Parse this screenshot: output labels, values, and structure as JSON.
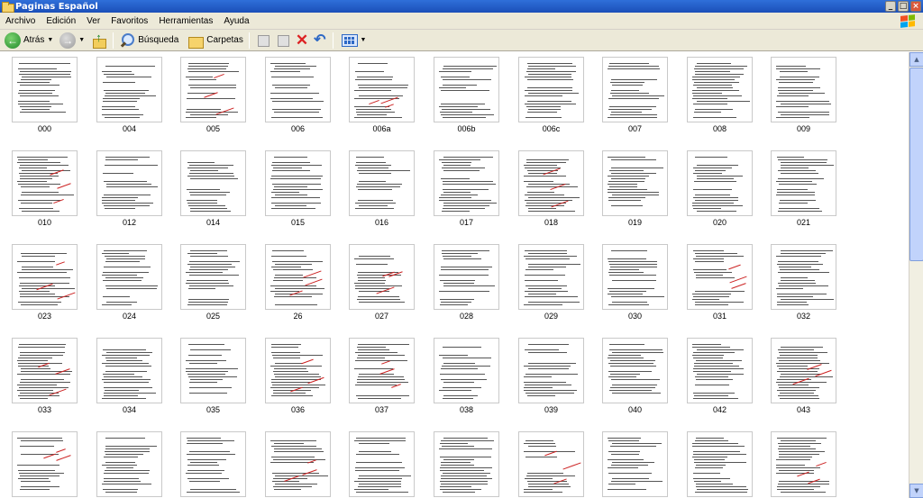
{
  "window": {
    "title": "Paginas Español"
  },
  "menu": [
    "Archivo",
    "Edición",
    "Ver",
    "Favoritos",
    "Herramientas",
    "Ayuda"
  ],
  "toolbar": {
    "back_label": "Atrás",
    "search_label": "Búsqueda",
    "folders_label": "Carpetas"
  },
  "files": [
    "000",
    "004",
    "005",
    "006",
    "006a",
    "006b",
    "006c",
    "007",
    "008",
    "009",
    "010",
    "012",
    "014",
    "015",
    "016",
    "017",
    "018",
    "019",
    "020",
    "021",
    "023",
    "024",
    "025",
    "26",
    "027",
    "028",
    "029",
    "030",
    "031",
    "032",
    "033",
    "034",
    "035",
    "036",
    "037",
    "038",
    "039",
    "040",
    "042",
    "043",
    "",
    "",
    "",
    "",
    "",
    "",
    "",
    "",
    "",
    ""
  ]
}
